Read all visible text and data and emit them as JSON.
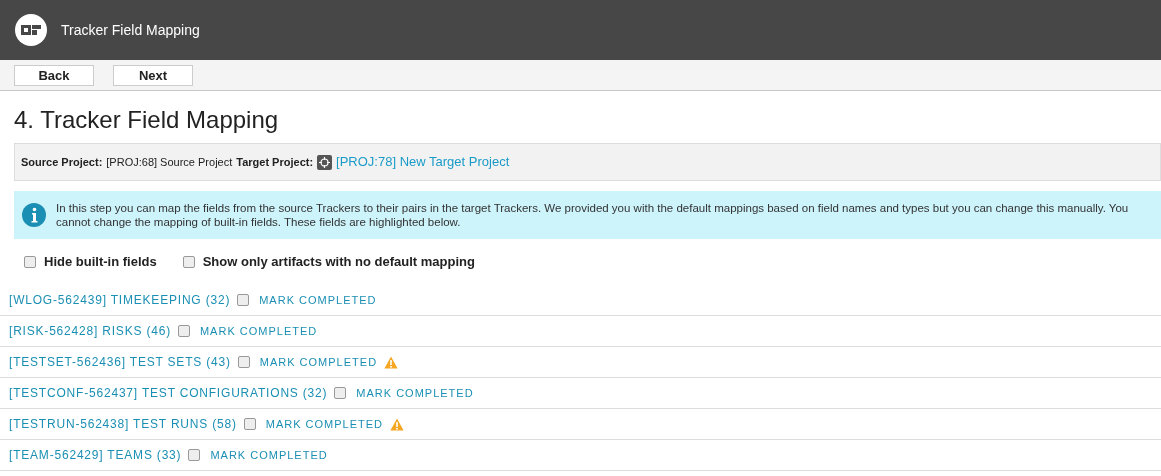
{
  "window": {
    "title": "Tracker Field Mapping"
  },
  "toolbar": {
    "buttons": [
      "Back",
      "Next"
    ]
  },
  "page": {
    "heading": "4. Tracker Field Mapping",
    "project_bar": {
      "source_label": "Source Project:",
      "source_value": "[PROJ:68] Source Project",
      "target_label": "Target Project:",
      "target_link": "[PROJ:78] New Target Project"
    },
    "info": "In this step you can map the fields from the source Trackers to their pairs in the target Trackers. We provided you with the default mappings based on field names and types but you can change this manually. You cannot change the mapping of built-in fields. These fields are highlighted below.",
    "filters": [
      {
        "label": "Hide built-in fields",
        "checked": false
      },
      {
        "label": "Show only artifacts with no default mapping",
        "checked": false
      }
    ],
    "trackers": [
      {
        "name": "[WLOG-562439] TIMEKEEPING (32)",
        "mark_label": "MARK COMPLETED",
        "checked": false,
        "warning": false
      },
      {
        "name": "[RISK-562428] RISKS (46)",
        "mark_label": "MARK COMPLETED",
        "checked": false,
        "warning": false
      },
      {
        "name": "[TESTSET-562436] TEST SETS (43)",
        "mark_label": "MARK COMPLETED",
        "checked": false,
        "warning": true
      },
      {
        "name": "[TESTCONF-562437] TEST CONFIGURATIONS (32)",
        "mark_label": "MARK COMPLETED",
        "checked": false,
        "warning": false
      },
      {
        "name": "[TESTRUN-562438] TEST RUNS (58)",
        "mark_label": "MARK COMPLETED",
        "checked": false,
        "warning": true
      },
      {
        "name": "[TEAM-562429] TEAMS (33)",
        "mark_label": "MARK COMPLETED",
        "checked": false,
        "warning": false
      }
    ]
  }
}
